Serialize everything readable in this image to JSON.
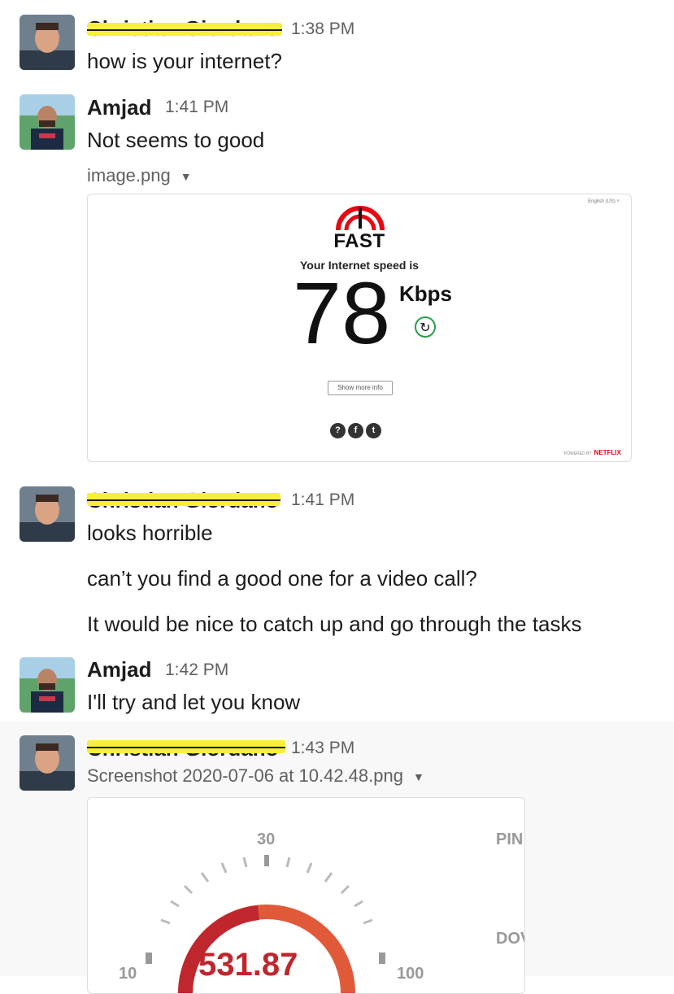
{
  "messages": [
    {
      "author": "Christian Giordano",
      "time": "1:38 PM",
      "lines": [
        "how is your internet?"
      ]
    },
    {
      "author": "Amjad",
      "time": "1:41 PM",
      "lines": [
        "Not seems to good"
      ],
      "file": {
        "name": "image.png"
      }
    },
    {
      "author": "Christian Giordano",
      "time": "1:41 PM",
      "lines": [
        "looks horrible",
        "can’t you find a good one for a video call?",
        "It would be nice to catch up and go through the tasks"
      ]
    },
    {
      "author": "Amjad",
      "time": "1:42 PM",
      "lines": [
        "I'll try and let you know"
      ]
    },
    {
      "author": "Christian Giordano",
      "time": "1:43 PM",
      "lines": [],
      "file": {
        "name": "Screenshot 2020-07-06 at 10.42.48.png"
      }
    }
  ],
  "fast_image": {
    "language": "English (US) ˅",
    "logo": "FAST",
    "subtitle": "Your Internet speed is",
    "speed": "78",
    "unit": "Kbps",
    "more_info": "Show more info",
    "social": [
      "?",
      "f",
      "t"
    ],
    "powered_by": "POWERED BY",
    "brand": "NETFLIX"
  },
  "speedtest_image": {
    "tick_30": "30",
    "tick_10": "10",
    "tick_100": "100",
    "ping_label": "PIN",
    "down_label": "DOV",
    "value": "531.87",
    "accent": "#c0262d"
  },
  "colors": {
    "redact_highlight": "#f7ef3a",
    "fast_red": "#e50914",
    "refresh_green": "#24a148"
  }
}
